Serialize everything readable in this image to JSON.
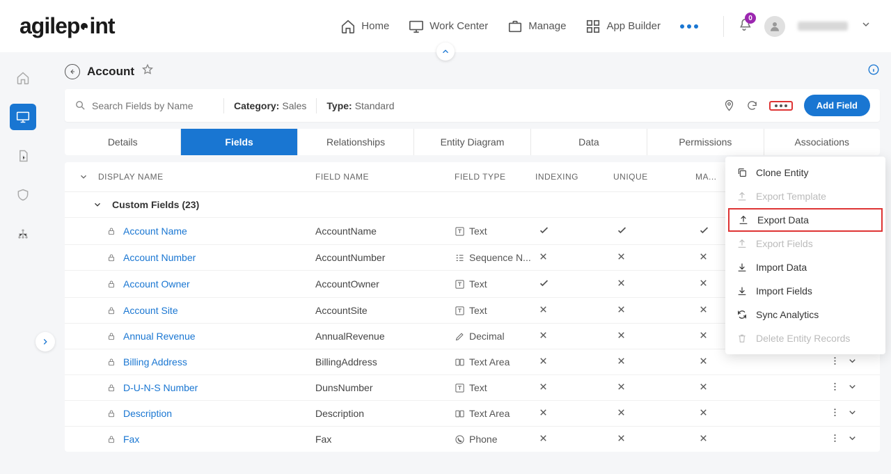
{
  "topnav": {
    "home": "Home",
    "workcenter": "Work Center",
    "manage": "Manage",
    "appbuilder": "App Builder"
  },
  "notifications": {
    "count": "0"
  },
  "page": {
    "title": "Account"
  },
  "filter": {
    "search_ph": "Search Fields by Name",
    "category_label": "Category:",
    "category_val": "Sales",
    "type_label": "Type:",
    "type_val": "Standard",
    "addfield": "Add Field"
  },
  "tabs": [
    "Details",
    "Fields",
    "Relationships",
    "Entity Diagram",
    "Data",
    "Permissions",
    "Associations"
  ],
  "columns": {
    "dn": "DISPLAY NAME",
    "fn": "FIELD NAME",
    "ft": "FIELD TYPE",
    "ix": "INDEXING",
    "uq": "UNIQUE",
    "ma": "MA..."
  },
  "group": {
    "label": "Custom Fields (23)"
  },
  "rows": [
    {
      "dn": "Account Name",
      "fn": "AccountName",
      "ft": "Text",
      "fti": "text",
      "ix": true,
      "uq": true,
      "ma": true
    },
    {
      "dn": "Account Number",
      "fn": "AccountNumber",
      "ft": "Sequence N...",
      "fti": "seq",
      "ix": false,
      "uq": false,
      "ma": false
    },
    {
      "dn": "Account Owner",
      "fn": "AccountOwner",
      "ft": "Text",
      "fti": "text",
      "ix": true,
      "uq": false,
      "ma": false
    },
    {
      "dn": "Account Site",
      "fn": "AccountSite",
      "ft": "Text",
      "fti": "text",
      "ix": false,
      "uq": false,
      "ma": false
    },
    {
      "dn": "Annual Revenue",
      "fn": "AnnualRevenue",
      "ft": "Decimal",
      "fti": "decimal",
      "ix": false,
      "uq": false,
      "ma": false
    },
    {
      "dn": "Billing Address",
      "fn": "BillingAddress",
      "ft": "Text Area",
      "fti": "textarea",
      "ix": false,
      "uq": false,
      "ma": false
    },
    {
      "dn": "D-U-N-S Number",
      "fn": "DunsNumber",
      "ft": "Text",
      "fti": "text",
      "ix": false,
      "uq": false,
      "ma": false
    },
    {
      "dn": "Description",
      "fn": "Description",
      "ft": "Text Area",
      "fti": "textarea",
      "ix": false,
      "uq": false,
      "ma": false
    },
    {
      "dn": "Fax",
      "fn": "Fax",
      "ft": "Phone",
      "fti": "phone",
      "ix": false,
      "uq": false,
      "ma": false
    }
  ],
  "dropdown": [
    {
      "label": "Clone Entity",
      "icon": "copy",
      "disabled": false
    },
    {
      "label": "Export Template",
      "icon": "upload",
      "disabled": true
    },
    {
      "label": "Export Data",
      "icon": "upload",
      "disabled": false,
      "highlight": true
    },
    {
      "label": "Export Fields",
      "icon": "upload",
      "disabled": true
    },
    {
      "label": "Import Data",
      "icon": "download",
      "disabled": false
    },
    {
      "label": "Import Fields",
      "icon": "download",
      "disabled": false
    },
    {
      "label": "Sync Analytics",
      "icon": "sync",
      "disabled": false
    },
    {
      "label": "Delete Entity Records",
      "icon": "trash",
      "disabled": true
    }
  ]
}
